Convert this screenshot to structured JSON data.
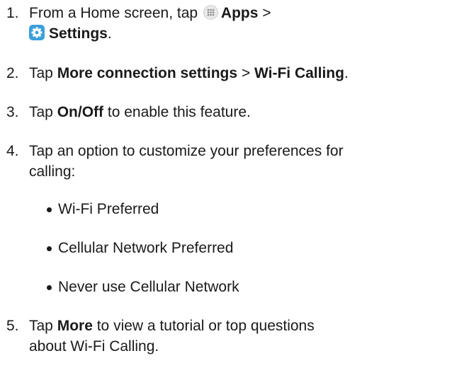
{
  "steps": [
    {
      "number": "1.",
      "line1_prefix": "From a Home screen, tap ",
      "apps_label": "Apps",
      "separator": " >",
      "settings_label": "Settings",
      "end": "."
    },
    {
      "number": "2.",
      "prefix": "Tap ",
      "bold1": "More connection settings",
      "separator": " > ",
      "bold2": "Wi-Fi Calling",
      "end": "."
    },
    {
      "number": "3.",
      "prefix": "Tap ",
      "bold1": "On/Off",
      "suffix": " to enable this feature."
    },
    {
      "number": "4.",
      "line1": "Tap an option to customize your preferences for",
      "line2": "calling:"
    },
    {
      "number": "5.",
      "prefix": "Tap ",
      "bold1": "More",
      "suffix": " to view a tutorial or top questions",
      "line2": "about Wi-Fi Calling."
    }
  ],
  "options": [
    "Wi-Fi Preferred",
    "Cellular Network Preferred",
    "Never use Cellular Network"
  ],
  "icons": {
    "apps": "apps-grid-icon",
    "settings": "settings-gear-icon"
  },
  "colors": {
    "text": "#1a1a1a",
    "settings_icon_bg": "#3aa0dc",
    "apps_icon_bg": "#e9e9e9"
  }
}
